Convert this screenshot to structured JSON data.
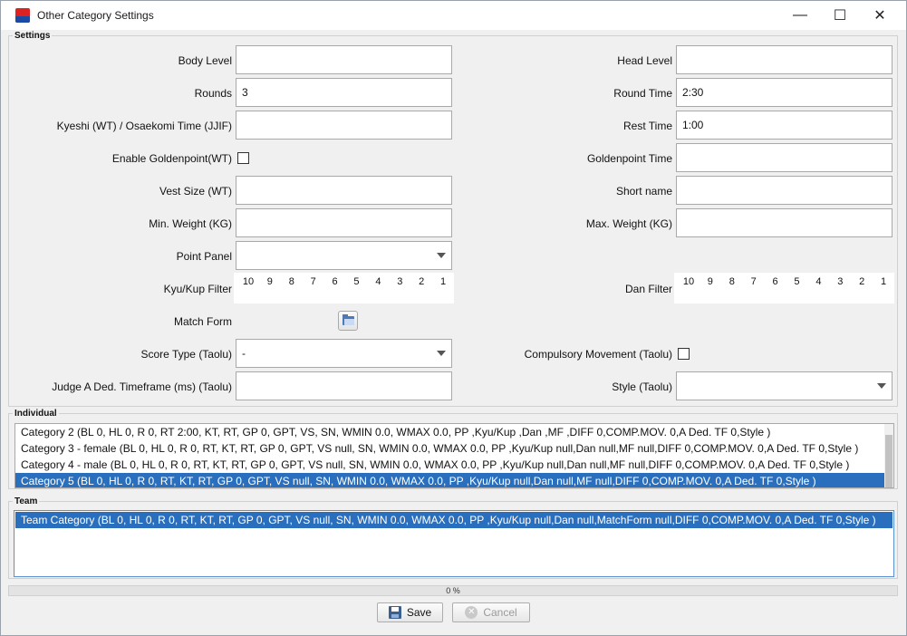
{
  "window": {
    "title": "Other Category Settings",
    "minimize_glyph": "—",
    "maximize_glyph": "☐",
    "close_glyph": "✕"
  },
  "settings": {
    "group_label": "Settings",
    "body_level": {
      "label": "Body Level",
      "value": ""
    },
    "head_level": {
      "label": "Head Level",
      "value": ""
    },
    "rounds": {
      "label": "Rounds",
      "value": "3"
    },
    "round_time": {
      "label": "Round Time",
      "value": "2:30"
    },
    "kyeshi": {
      "label": "Kyeshi (WT) / Osaekomi Time (JJIF)",
      "value": ""
    },
    "rest_time": {
      "label": "Rest Time",
      "value": "1:00"
    },
    "enable_goldenpoint": {
      "label": "Enable Goldenpoint(WT)",
      "checked": false
    },
    "goldenpoint_time": {
      "label": "Goldenpoint Time",
      "value": ""
    },
    "vest_size": {
      "label": "Vest Size (WT)",
      "value": ""
    },
    "short_name": {
      "label": "Short name",
      "value": ""
    },
    "min_weight": {
      "label": "Min. Weight (KG)",
      "value": ""
    },
    "max_weight": {
      "label": "Max. Weight (KG)",
      "value": ""
    },
    "point_panel": {
      "label": "Point Panel",
      "value": ""
    },
    "kyu_filter": {
      "label": "Kyu/Kup Filter",
      "values": [
        "10",
        "9",
        "8",
        "7",
        "6",
        "5",
        "4",
        "3",
        "2",
        "1"
      ]
    },
    "dan_filter": {
      "label": "Dan Filter",
      "values": [
        "10",
        "9",
        "8",
        "7",
        "6",
        "5",
        "4",
        "3",
        "2",
        "1"
      ]
    },
    "match_form": {
      "label": "Match Form",
      "icon": "folder-open-icon"
    },
    "score_type": {
      "label": "Score Type (Taolu)",
      "value": "-"
    },
    "compulsory_movement": {
      "label": "Compulsory Movement (Taolu)",
      "checked": false
    },
    "judge_a": {
      "label": "Judge A Ded. Timeframe (ms) (Taolu)",
      "value": ""
    },
    "style": {
      "label": "Style (Taolu)",
      "value": ""
    }
  },
  "individual": {
    "group_label": "Individual",
    "items": [
      "Category 2 (BL 0, HL 0, R 0, RT 2:00, KT, RT, GP 0, GPT, VS, SN, WMIN 0.0, WMAX 0.0, PP ,Kyu/Kup ,Dan ,MF ,DIFF 0,COMP.MOV. 0,A Ded. TF 0,Style )",
      "Category 3 - female (BL 0, HL 0, R 0, RT, KT, RT, GP 0, GPT, VS null, SN, WMIN 0.0, WMAX 0.0, PP ,Kyu/Kup null,Dan null,MF null,DIFF 0,COMP.MOV. 0,A Ded. TF 0,Style )",
      "Category 4 - male (BL 0, HL 0, R 0, RT, KT, RT, GP 0, GPT, VS null, SN, WMIN 0.0, WMAX 0.0, PP ,Kyu/Kup null,Dan null,MF null,DIFF 0,COMP.MOV. 0,A Ded. TF 0,Style )",
      "Category 5 (BL 0, HL 0, R 0, RT, KT, RT, GP 0, GPT, VS null, SN, WMIN 0.0, WMAX 0.0, PP ,Kyu/Kup null,Dan null,MF null,DIFF 0,COMP.MOV. 0,A Ded. TF 0,Style )"
    ],
    "selected_index": 3
  },
  "team": {
    "group_label": "Team",
    "items": [
      "Team Category (BL 0, HL 0, R 0, RT, KT, RT, GP 0, GPT, VS null, SN, WMIN 0.0, WMAX 0.0, PP ,Kyu/Kup null,Dan null,MatchForm null,DIFF 0,COMP.MOV. 0,A Ded. TF 0,Style )"
    ],
    "selected_index": 0
  },
  "progress": {
    "text": "0 %",
    "value": 0
  },
  "buttons": {
    "save": "Save",
    "cancel": "Cancel"
  },
  "colors": {
    "selection": "#2a6fbd"
  }
}
